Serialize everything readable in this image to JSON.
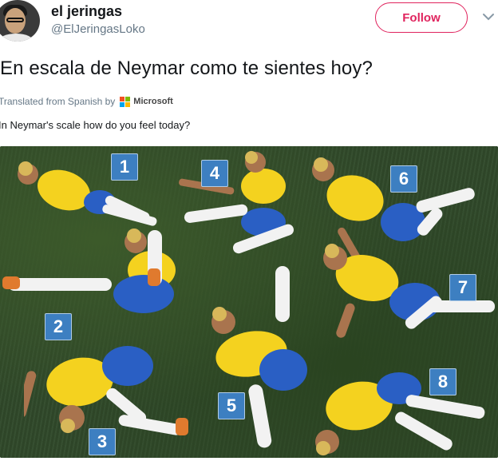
{
  "tweet": {
    "display_name": "el jeringas",
    "handle": "@ElJeringasLoko",
    "follow_label": "Follow",
    "text": "En escala de Neymar como te sientes hoy?",
    "translated_from": "Translated from Spanish by",
    "translator": "Microsoft",
    "translation": "In Neymar's scale how do you feel today?"
  },
  "icons": {
    "chevron": "chevron-down-icon",
    "translator_logo": "microsoft-logo-icon"
  },
  "colors": {
    "follow_accent": "#e0245e",
    "badge_blue": "#3d7fc1",
    "jersey_yellow": "#f4d21f",
    "shorts_blue": "#2a5fc4",
    "grass_green": "#30492a"
  },
  "photo": {
    "badges": [
      "1",
      "4",
      "6",
      "2",
      "7",
      "3",
      "5",
      "8"
    ]
  }
}
